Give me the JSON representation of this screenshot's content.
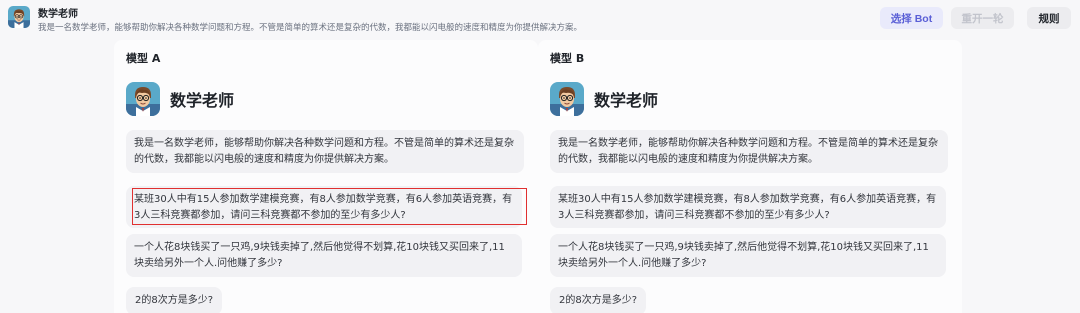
{
  "header": {
    "title": "数学老师",
    "description": "我是一名数学老师，能够帮助你解决各种数学问题和方程。不管是简单的算术还是复杂的代数，我都能以闪电般的速度和精度为你提供解决方案。",
    "avatar_icon": "math-teacher-avatar-icon"
  },
  "toolbar": {
    "select_bot_label": "选择 Bot",
    "restart_label": "重开一轮",
    "rules_label": "规则"
  },
  "colors": {
    "accent": "#5a5fd6",
    "highlight_border": "#e03030",
    "bubble_bg": "#f1f1f4"
  },
  "panels": [
    {
      "label": "模型 A",
      "bot_name": "数学老师",
      "intro": "我是一名数学老师，能够帮助你解决各种数学问题和方程。不管是简单的算术还是复杂的代数，我都能以闪电般的速度和精度为你提供解决方案。",
      "questions": [
        "某班30人中有15人参加数学建模竞赛，有8人参加数学竞赛，有6人参加英语竞赛，有3人三科竞赛都参加，请问三科竞赛都不参加的至少有多少人?",
        "一个人花8块钱买了一只鸡,9块钱卖掉了,然后他觉得不划算,花10块钱又买回来了,11块卖给另外一个人.问他赚了多少?",
        "2的8次方是多少?"
      ]
    },
    {
      "label": "模型 B",
      "bot_name": "数学老师",
      "intro": "我是一名数学老师，能够帮助你解决各种数学问题和方程。不管是简单的算术还是复杂的代数，我都能以闪电般的速度和精度为你提供解决方案。",
      "questions": [
        "某班30人中有15人参加数学建模竞赛，有8人参加数学竞赛，有6人参加英语竞赛，有3人三科竞赛都参加，请问三科竞赛都不参加的至少有多少人?",
        "一个人花8块钱买了一只鸡,9块钱卖掉了,然后他觉得不划算,花10块钱又买回来了,11块卖给另外一个人.问他赚了多少?",
        "2的8次方是多少?"
      ]
    }
  ]
}
